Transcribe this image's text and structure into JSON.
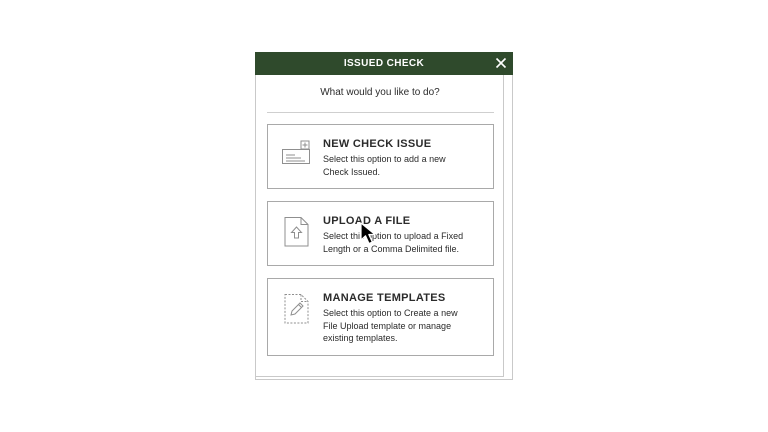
{
  "dialog": {
    "title": "ISSUED CHECK",
    "close_icon": "close-icon",
    "prompt": "What would you like to do?"
  },
  "options": [
    {
      "title": "NEW CHECK ISSUE",
      "description": "Select this option to add a new Check Issued.",
      "icon": "check-plus-icon"
    },
    {
      "title": "UPLOAD A FILE",
      "description": "Select this option to upload a Fixed Length or a Comma Delimited file.",
      "icon": "file-upload-icon"
    },
    {
      "title": "MANAGE TEMPLATES",
      "description": "Select this option to Create a new File Upload template or manage existing templates.",
      "icon": "template-edit-icon"
    }
  ],
  "colors": {
    "titlebar": "#2f4a2c",
    "title_text": "#ffffff",
    "border": "#a9a9a9"
  },
  "pointer": "arrow-cursor-icon"
}
